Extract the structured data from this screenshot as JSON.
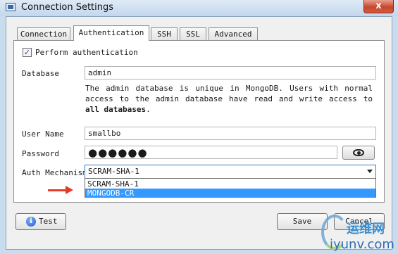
{
  "window": {
    "title": "Connection Settings",
    "close_glyph": "x"
  },
  "tabs": [
    {
      "label": "Connection"
    },
    {
      "label": "Authentication"
    },
    {
      "label": "SSH"
    },
    {
      "label": "SSL"
    },
    {
      "label": "Advanced"
    }
  ],
  "auth": {
    "perform_label": "Perform authentication",
    "perform_checked": true,
    "database_label": "Database",
    "database_value": "admin",
    "note_part1": "The admin database is unique in MongoDB. Users with normal access to the admin database have read and write access to ",
    "note_bold": "all databases",
    "note_end": ".",
    "username_label": "User Name",
    "username_value": "smallbo",
    "password_label": "Password",
    "password_value": "●●●●●●",
    "mechanism_label": "Auth Mechanism",
    "mechanism_selected": "SCRAM-SHA-1",
    "mechanism_options": [
      "SCRAM-SHA-1",
      "MONGODB-CR"
    ],
    "highlighted_option": "MONGODB-CR"
  },
  "buttons": {
    "test": "Test",
    "save": "Save",
    "cancel": "Cancel"
  },
  "watermark": {
    "cn": "运维网",
    "en": "iyunv.com"
  },
  "colors": {
    "highlight": "#3399ff",
    "arrow": "#e23b2a",
    "close": "#c6462f"
  },
  "icons": {
    "app": "window-icon",
    "close": "close-icon",
    "eye": "eye-icon",
    "info": "info-icon",
    "arrow": "red-arrow-icon"
  }
}
